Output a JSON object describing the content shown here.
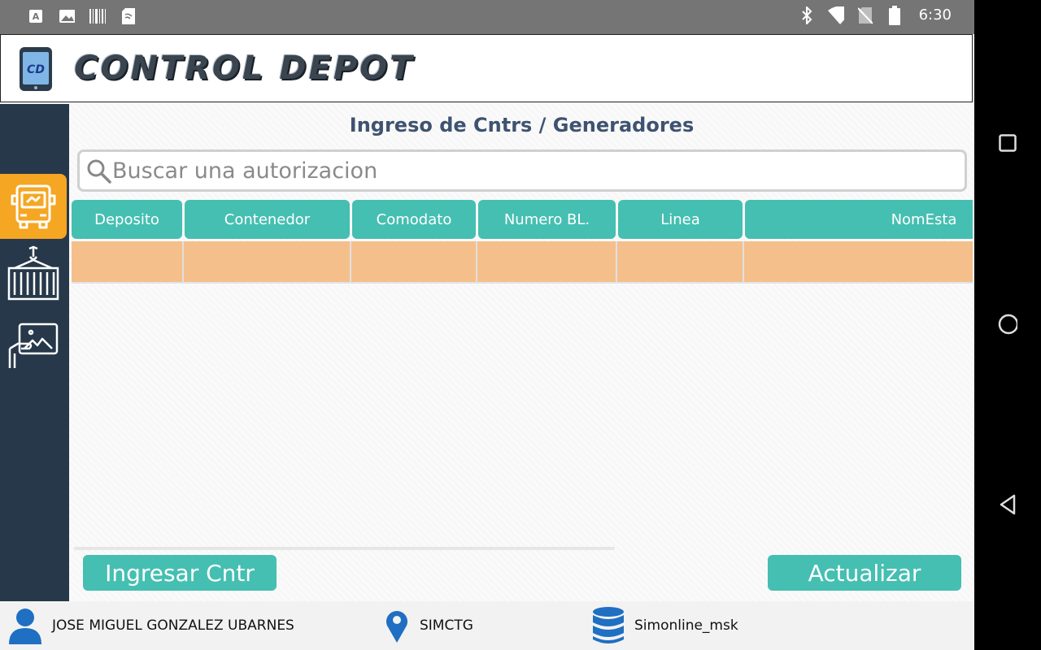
{
  "status_bar": {
    "time": "6:30",
    "left_icons": [
      "keyboard-a-icon",
      "image-icon",
      "barcode-icon",
      "sim-card-icon"
    ],
    "right_icons": [
      "bluetooth-icon",
      "wifi-icon",
      "no-sim-icon",
      "battery-icon"
    ]
  },
  "app": {
    "title": "CONTROL DEPOT",
    "logo_text": "CD"
  },
  "sidebar": {
    "items": [
      {
        "icon": "truck-icon",
        "active": true
      },
      {
        "icon": "container-crane-icon",
        "active": false
      },
      {
        "icon": "hand-photo-icon",
        "active": false
      }
    ]
  },
  "page": {
    "title": "Ingreso de Cntrs / Generadores",
    "search_placeholder": "Buscar una autorizacion"
  },
  "table": {
    "columns": [
      "Deposito",
      "Contenedor",
      "Comodato",
      "Numero BL.",
      "Linea",
      "NomEsta"
    ],
    "rows": [
      [
        "",
        "",
        "",
        "",
        "",
        ""
      ]
    ]
  },
  "actions": {
    "ingresar_label": "Ingresar Cntr",
    "actualizar_label": "Actualizar"
  },
  "footer": {
    "user": "JOSE MIGUEL GONZALEZ UBARNES",
    "location": "SIMCTG",
    "database": "Simonline_msk"
  },
  "colors": {
    "accent": "#45bfb1",
    "row_highlight": "#f5bf8b",
    "sidebar_bg": "#27384a",
    "sidebar_active": "#f5a623",
    "title_text": "#3e5370",
    "footer_icon": "#1f6fc2"
  }
}
